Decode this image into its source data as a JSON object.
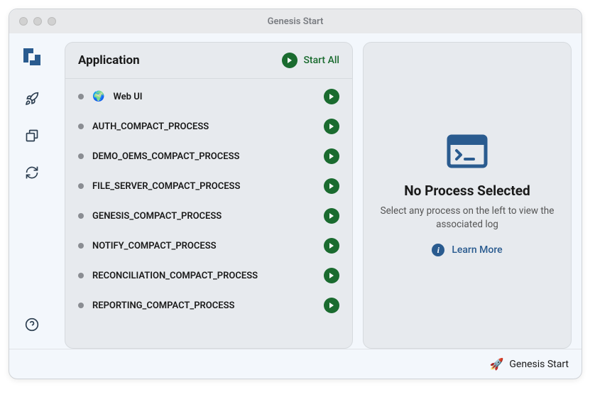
{
  "window_title": "Genesis Start",
  "panel": {
    "title": "Application",
    "start_all_label": "Start All"
  },
  "processes": [
    {
      "name": "Web UI",
      "icon": "🌍"
    },
    {
      "name": "AUTH_COMPACT_PROCESS",
      "icon": ""
    },
    {
      "name": "DEMO_OEMS_COMPACT_PROCESS",
      "icon": ""
    },
    {
      "name": "FILE_SERVER_COMPACT_PROCESS",
      "icon": ""
    },
    {
      "name": "GENESIS_COMPACT_PROCESS",
      "icon": ""
    },
    {
      "name": "NOTIFY_COMPACT_PROCESS",
      "icon": ""
    },
    {
      "name": "RECONCILIATION_COMPACT_PROCESS",
      "icon": ""
    },
    {
      "name": "REPORTING_COMPACT_PROCESS",
      "icon": ""
    }
  ],
  "empty_state": {
    "title": "No Process Selected",
    "description": "Select any process on the left to view the associated log",
    "learn_more_label": "Learn More"
  },
  "footer": {
    "label": "Genesis Start",
    "icon": "🚀"
  }
}
